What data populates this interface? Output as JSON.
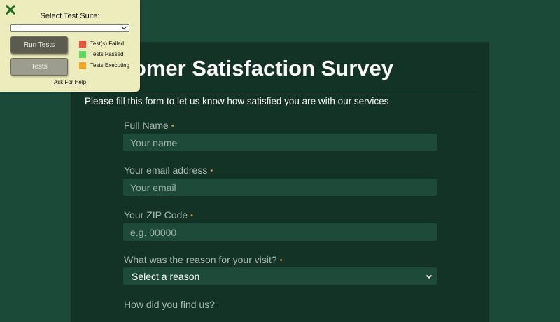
{
  "survey": {
    "title": "Customer Satisfaction Survey",
    "intro": "Please fill this form to let us know how satisfied you are with our services",
    "required_marker": "•",
    "fields": [
      {
        "label": "Full Name",
        "placeholder": "Your name",
        "value": ""
      },
      {
        "label": "Your email address",
        "placeholder": "Your email",
        "value": ""
      },
      {
        "label": "Your ZIP Code",
        "placeholder": "e.g. 00000",
        "value": ""
      },
      {
        "label": "What was the reason for your visit?",
        "selected": "Select a reason"
      },
      {
        "label": "How did you find us?"
      }
    ]
  },
  "test_panel": {
    "heading": "Select Test Suite:",
    "suite_selected": "- - -",
    "run_button": "Run Tests",
    "tests_button": "Tests",
    "help_link": "Ask For Help",
    "legend": [
      {
        "label": "Test(s) Failed",
        "color": "#e8503a"
      },
      {
        "label": "Tests Passed",
        "color": "#5cd65c"
      },
      {
        "label": "Tests Executing",
        "color": "#f2a324"
      }
    ],
    "close_icon": "close-icon",
    "close_color": "#1f6b1f"
  },
  "colors": {
    "page_background": "#1c4a39",
    "card_background": "#133326",
    "input_background": "#1d4a39",
    "panel_background": "#ececbd"
  }
}
